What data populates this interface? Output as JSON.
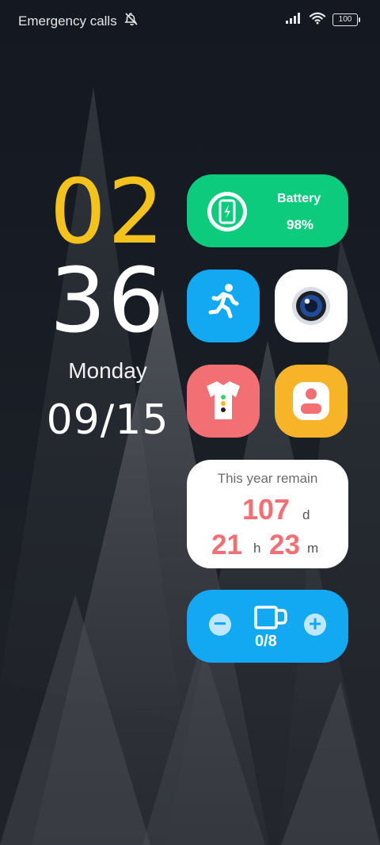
{
  "status_bar": {
    "carrier_text": "Emergency calls",
    "battery_level": "100"
  },
  "clock": {
    "hour": "02",
    "minute": "36",
    "weekday": "Monday",
    "date": "09/15"
  },
  "battery_widget": {
    "label": "Battery",
    "value": "98%"
  },
  "year_remain_widget": {
    "title": "This year remain",
    "days": "107",
    "days_unit": "d",
    "hours": "21",
    "hours_unit": "h",
    "minutes": "23",
    "minutes_unit": "m"
  },
  "water_widget": {
    "count": "0/8"
  },
  "icons": {
    "silent": "bell-off-icon",
    "signal": "signal-icon",
    "wifi": "wifi-icon",
    "battery": "battery-icon",
    "phone_charge": "phone-battery-icon",
    "runner": "running-icon",
    "camera": "camera-icon",
    "shirt": "shirt-icon",
    "profile": "profile-icon",
    "cup": "cup-icon"
  },
  "colors": {
    "hour": "#f4c21c",
    "battery_card": "#0ccb7c",
    "blue_tile": "#12a8f2",
    "red_tile": "#f26f73",
    "orange_tile": "#f8b429",
    "remain_number": "#f26f73"
  }
}
